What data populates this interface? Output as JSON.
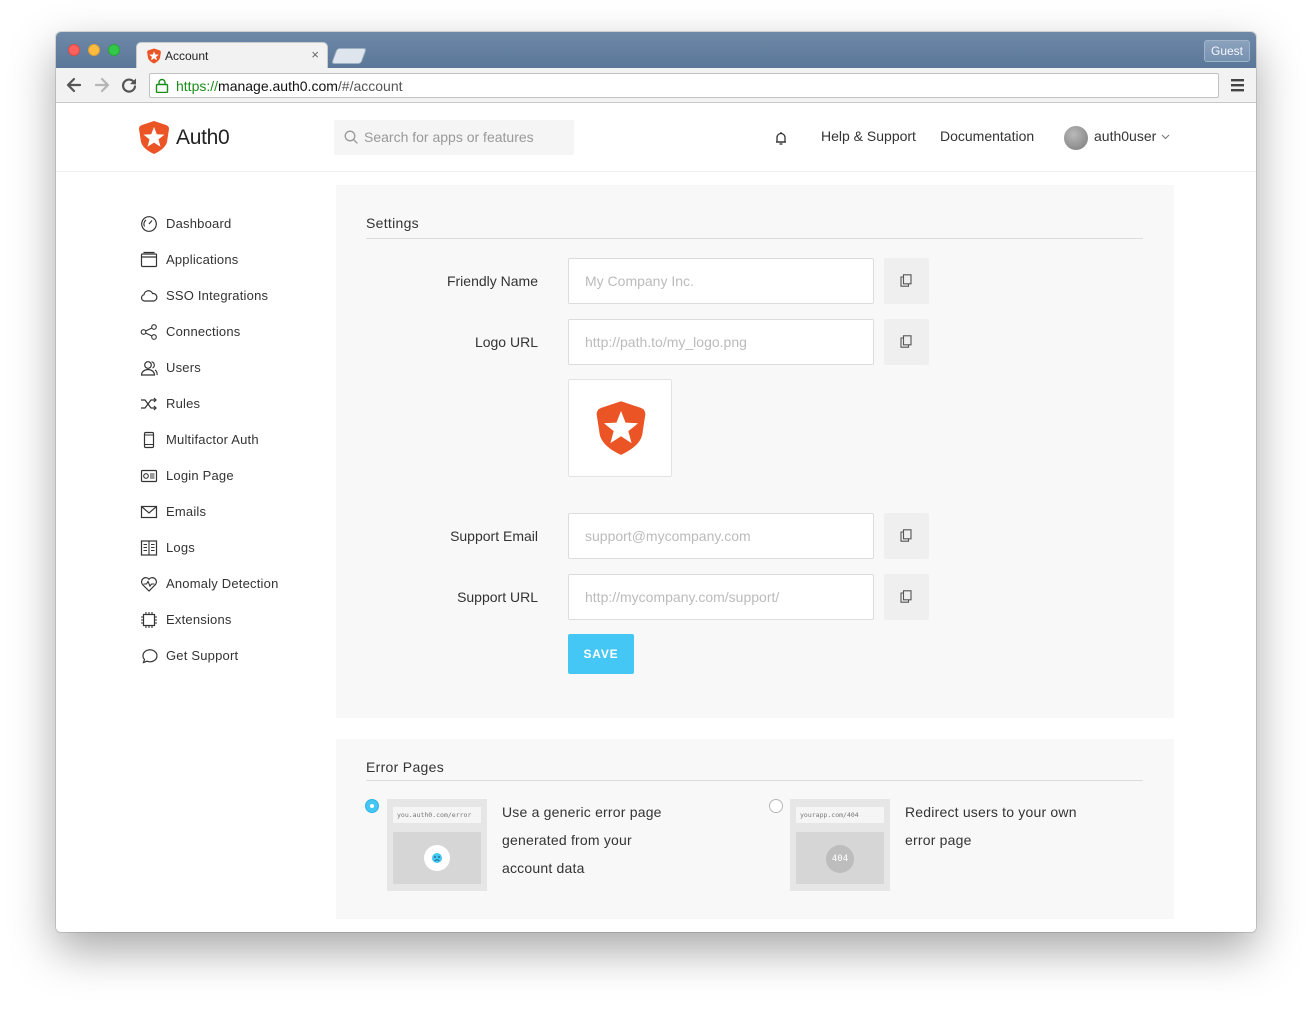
{
  "browser": {
    "tab_title": "Account",
    "tab_close": "×",
    "guest_label": "Guest",
    "url_scheme": "https://",
    "url_host": "manage.auth0.com",
    "url_path": "/#/account"
  },
  "header": {
    "brand": "Auth0",
    "search_placeholder": "Search for apps or features",
    "help_link": "Help & Support",
    "docs_link": "Documentation",
    "username": "auth0user"
  },
  "sidebar": {
    "items": [
      {
        "label": "Dashboard",
        "icon": "dashboard-icon"
      },
      {
        "label": "Applications",
        "icon": "applications-icon"
      },
      {
        "label": "SSO Integrations",
        "icon": "cloud-icon"
      },
      {
        "label": "Connections",
        "icon": "connections-icon"
      },
      {
        "label": "Users",
        "icon": "users-icon"
      },
      {
        "label": "Rules",
        "icon": "rules-icon"
      },
      {
        "label": "Multifactor Auth",
        "icon": "mobile-icon"
      },
      {
        "label": "Login Page",
        "icon": "login-page-icon"
      },
      {
        "label": "Emails",
        "icon": "envelope-icon"
      },
      {
        "label": "Logs",
        "icon": "logs-icon"
      },
      {
        "label": "Anomaly Detection",
        "icon": "heart-pulse-icon"
      },
      {
        "label": "Extensions",
        "icon": "chip-icon"
      },
      {
        "label": "Get Support",
        "icon": "chat-bubble-icon"
      }
    ]
  },
  "settings": {
    "title": "Settings",
    "friendly_name_label": "Friendly Name",
    "friendly_name_placeholder": "My Company Inc.",
    "logo_url_label": "Logo URL",
    "logo_url_placeholder": "http://path.to/my_logo.png",
    "support_email_label": "Support Email",
    "support_email_placeholder": "support@mycompany.com",
    "support_url_label": "Support URL",
    "support_url_placeholder": "http://mycompany.com/support/",
    "save_label": "SAVE"
  },
  "error_pages": {
    "title": "Error Pages",
    "option_generic": {
      "selected": true,
      "thumb_url": "you.auth0.com/error",
      "text_line1": "Use a generic error page",
      "text_line2": "generated from your",
      "text_line3": "account data"
    },
    "option_redirect": {
      "selected": false,
      "thumb_url": "yourapp.com/404",
      "thumb_badge": "404",
      "text_line1": "Redirect users to your own",
      "text_line2": "error page"
    }
  },
  "colors": {
    "brand_orange": "#eb5424",
    "accent_blue": "#44c7f4",
    "titlebar": "#6581a1"
  }
}
